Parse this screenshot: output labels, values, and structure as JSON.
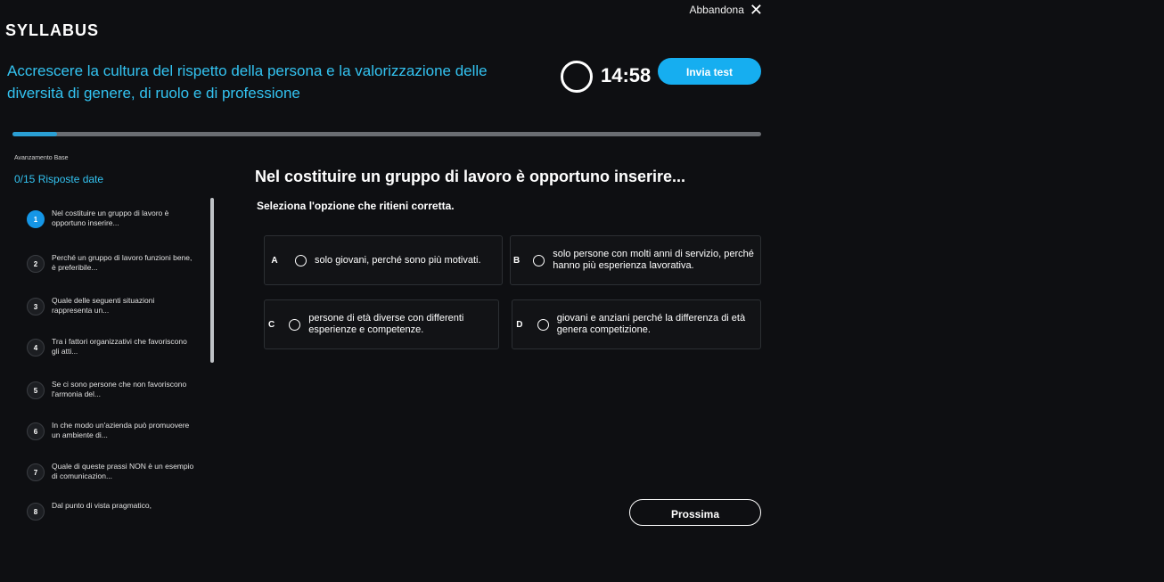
{
  "header": {
    "abandon_label": "Abbandona",
    "logo": "SYLLABUS"
  },
  "course": {
    "title": "Accrescere la cultura del rispetto della persona e la valorizzazione delle diversità di genere, di ruolo e di professione"
  },
  "timer": {
    "value": "14:58"
  },
  "send_button": {
    "label": "Invia test"
  },
  "progress": {
    "label": "Avanzamento Base",
    "fraction": 0.06
  },
  "answered": {
    "text": "0/15 Risposte date"
  },
  "question": {
    "title": "Nel costituire un gruppo di lavoro è opportuno inserire...",
    "instruction": "Seleziona l'opzione che ritieni corretta.",
    "options": [
      {
        "letter": "A",
        "text": "solo giovani, perché sono più motivati."
      },
      {
        "letter": "B",
        "text": "solo persone con molti anni di servizio, perché hanno più esperienza lavorativa."
      },
      {
        "letter": "C",
        "text": "persone di età diverse con differenti esperienze e competenze."
      },
      {
        "letter": "D",
        "text": "giovani e anziani perché la differenza di età genera competizione."
      }
    ]
  },
  "sidebar": {
    "items": [
      {
        "num": "1",
        "text": "Nel costituire un gruppo di lavoro è opportuno inserire..."
      },
      {
        "num": "2",
        "text": "Perché un gruppo di lavoro funzioni bene, è preferibile..."
      },
      {
        "num": "3",
        "text": "Quale delle seguenti situazioni rappresenta un..."
      },
      {
        "num": "4",
        "text": "Tra i fattori organizzativi che favoriscono gli atti..."
      },
      {
        "num": "5",
        "text": "Se ci sono persone che non favoriscono l'armonia del..."
      },
      {
        "num": "6",
        "text": "In che modo un'azienda può promuovere un ambiente di..."
      },
      {
        "num": "7",
        "text": "Quale di queste prassi NON è un esempio di comunicazion..."
      },
      {
        "num": "8",
        "text": "Dal punto di vista pragmatico,"
      }
    ]
  },
  "next_button": {
    "label": "Prossima"
  },
  "colors": {
    "accent": "#16aef0",
    "title": "#33c3f1",
    "background": "#0e0f12"
  },
  "icons": {
    "close": "close-icon",
    "timer": "timer-ring-icon",
    "radio": "radio-icon"
  }
}
